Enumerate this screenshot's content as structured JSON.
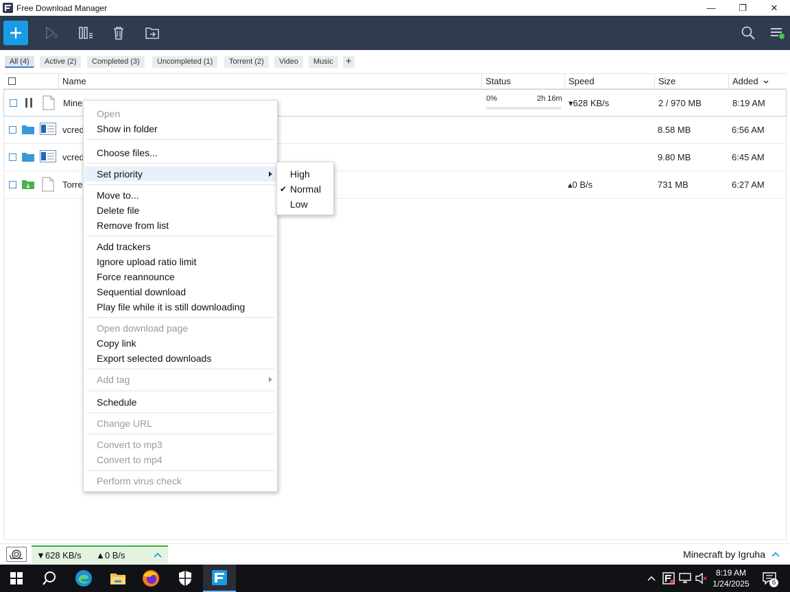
{
  "window": {
    "title": "Free Download Manager",
    "minimize": "—",
    "restore": "❐",
    "close": "✕"
  },
  "filters": [
    {
      "label": "All (4)"
    },
    {
      "label": "Active (2)"
    },
    {
      "label": "Completed (3)"
    },
    {
      "label": "Uncompleted (1)"
    },
    {
      "label": "Torrent (2)"
    },
    {
      "label": "Video"
    },
    {
      "label": "Music"
    }
  ],
  "filter_add": "+",
  "columns": {
    "name": "Name",
    "status": "Status",
    "speed": "Speed",
    "size": "Size",
    "added": "Added",
    "sort_icon": "chevron-down-icon"
  },
  "rows": [
    {
      "name": "Mine",
      "status_percent": "0%",
      "status_eta": "2h 16m",
      "progress": 0,
      "speed": "▾628 KB/s",
      "size": "2 / 970 MB",
      "added": "8:19 AM",
      "icon": "pause-icon"
    },
    {
      "name": "vcred",
      "speed": "",
      "size": "8.58 MB",
      "added": "6:56 AM",
      "icon": "folder-icon"
    },
    {
      "name": "vcred",
      "speed": "",
      "size": "9.80 MB",
      "added": "6:45 AM",
      "icon": "folder-icon"
    },
    {
      "name": "Torre",
      "speed": "▴0 B/s",
      "size": "731 MB",
      "added": "6:27 AM",
      "icon": "folder-green-icon"
    }
  ],
  "context_menu": {
    "open": "Open",
    "show_in_folder": "Show in folder",
    "choose_files": "Choose files...",
    "set_priority": "Set priority",
    "move_to": "Move to...",
    "delete_file": "Delete file",
    "remove_from_list": "Remove from list",
    "add_trackers": "Add trackers",
    "ignore_ratio": "Ignore upload ratio limit",
    "force_reannounce": "Force reannounce",
    "sequential": "Sequential download",
    "play_file": "Play file while it is still downloading",
    "open_page": "Open download page",
    "copy_link": "Copy link",
    "export": "Export selected downloads",
    "add_tag": "Add tag",
    "schedule": "Schedule",
    "change_url": "Change URL",
    "to_mp3": "Convert to mp3",
    "to_mp4": "Convert to mp4",
    "virus_check": "Perform virus check"
  },
  "priority_submenu": {
    "high": "High",
    "normal": "Normal",
    "low": "Low",
    "checkmark": "✔"
  },
  "statusbar": {
    "down_speed": "▼628 KB/s",
    "up_speed": "▲0 B/s",
    "current_item": "Minecraft by Igruha"
  },
  "taskbar": {
    "time": "8:19 AM",
    "date": "1/24/2025",
    "notifications": "6"
  },
  "colors": {
    "toolbar": "#2f3b4e",
    "accent": "#1a9be6",
    "speed_bar": "#3cae44"
  }
}
